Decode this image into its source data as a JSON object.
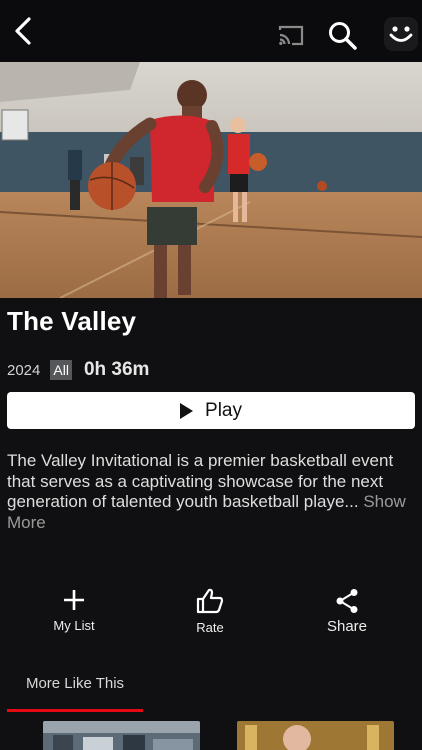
{
  "header": {
    "icons": [
      "back-icon",
      "cast-icon",
      "search-icon",
      "profile-smiley-icon"
    ]
  },
  "title": "The Valley",
  "meta": {
    "year": "2024",
    "rating": "All",
    "duration": "0h 36m"
  },
  "play_button": {
    "label": "Play",
    "icon": "play-icon"
  },
  "description": {
    "text": "The Valley Invitational is a premier basketball event that serves as a captivating showcase for the next generation of talented youth basketball playe... ",
    "show_more": "Show More"
  },
  "actions": [
    {
      "label": "My List",
      "icon": "plus-icon"
    },
    {
      "label": "Rate",
      "icon": "thumbs-up-icon"
    },
    {
      "label": "Share",
      "icon": "share-icon"
    }
  ],
  "tabs": [
    {
      "label": "More Like This",
      "active": true
    }
  ],
  "colors": {
    "background": "#101012",
    "accent": "#e50914",
    "play_button_bg": "#ffffff"
  }
}
